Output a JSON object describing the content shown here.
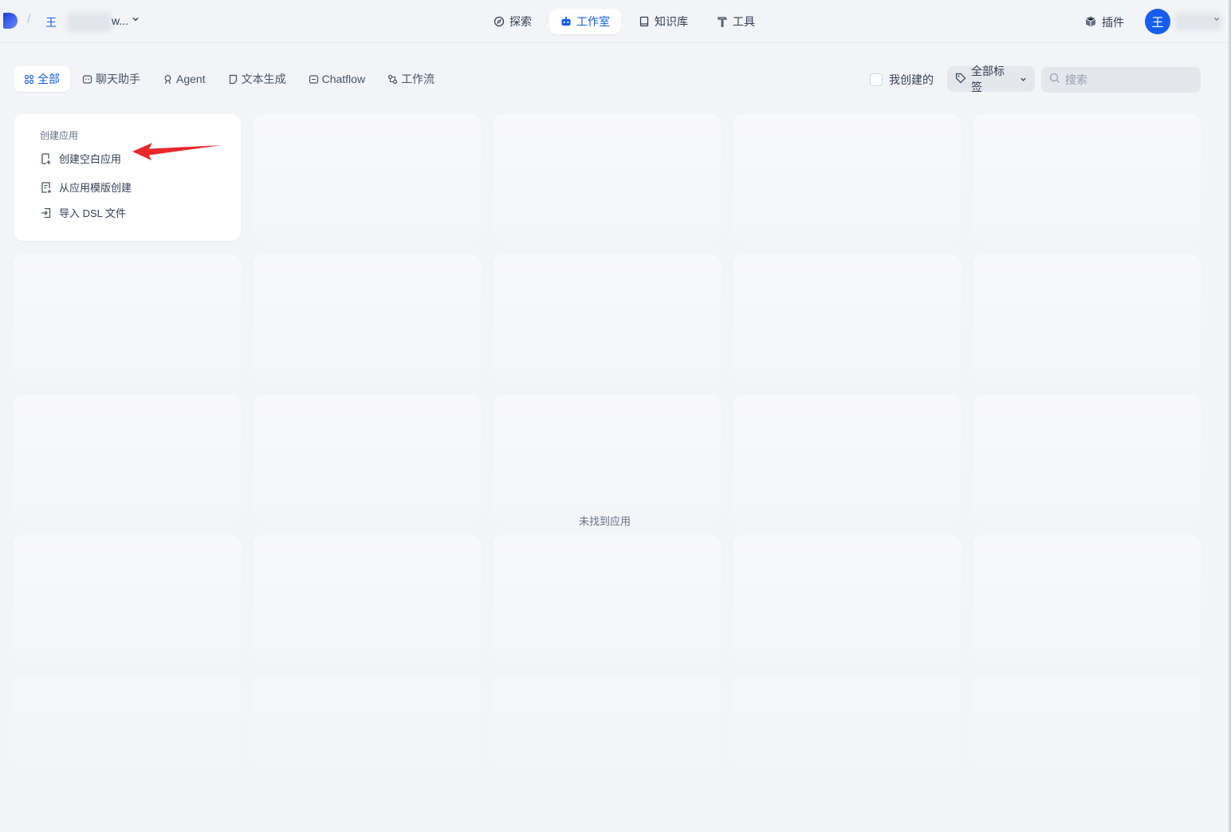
{
  "header": {
    "workspace_initial": "王",
    "workspace_suffix": "w...",
    "nav": [
      {
        "label": "探索",
        "icon": "compass-icon",
        "active": false
      },
      {
        "label": "工作室",
        "icon": "robot-icon",
        "active": true
      },
      {
        "label": "知识库",
        "icon": "book-icon",
        "active": false
      },
      {
        "label": "工具",
        "icon": "hammer-icon",
        "active": false
      }
    ],
    "plugin_label": "插件",
    "avatar_initial": "王"
  },
  "filters": {
    "tabs": [
      {
        "label": "全部",
        "icon": "grid-icon",
        "active": true
      },
      {
        "label": "聊天助手",
        "icon": "chat-icon",
        "active": false
      },
      {
        "label": "Agent",
        "icon": "agent-icon",
        "active": false
      },
      {
        "label": "文本生成",
        "icon": "document-icon",
        "active": false
      },
      {
        "label": "Chatflow",
        "icon": "chatflow-icon",
        "active": false
      },
      {
        "label": "工作流",
        "icon": "workflow-icon",
        "active": false
      }
    ],
    "mine_label": "我创建的",
    "tag_label": "全部标签",
    "search_placeholder": "搜索"
  },
  "create_card": {
    "title": "创建应用",
    "items": [
      {
        "label": "创建空白应用",
        "icon": "blank-app-icon"
      },
      {
        "label": "从应用模版创建",
        "icon": "template-icon"
      },
      {
        "label": "导入 DSL 文件",
        "icon": "import-icon"
      }
    ]
  },
  "empty_state": "未找到应用",
  "colors": {
    "accent": "#155eef",
    "annotation_arrow": "#e8282b",
    "background": "#f2f4f7"
  }
}
